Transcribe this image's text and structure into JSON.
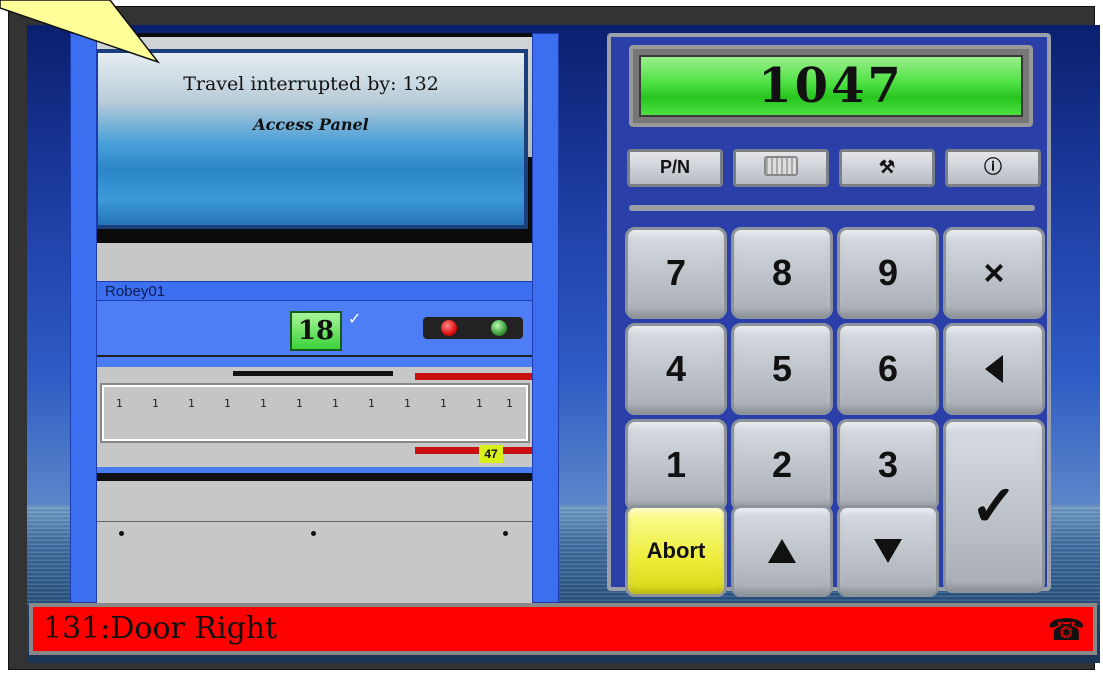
{
  "message": {
    "line1": "Travel interrupted by: 132",
    "line2": "Access Panel"
  },
  "machine": {
    "name": "Robey01",
    "level": "18",
    "level_check": "✓",
    "ruler_ticks": [
      "1",
      "1",
      "1",
      "1",
      "1",
      "1",
      "1",
      "1",
      "1",
      "1",
      "1",
      "1"
    ],
    "position_badge": "47"
  },
  "keypad": {
    "display_value": "1047",
    "tools": {
      "pn_label": "P/N",
      "keyboard_icon": "keyboard-icon",
      "tools_icon": "tools-icon",
      "info_icon": "info-icon"
    },
    "keys": {
      "k7": "7",
      "k8": "8",
      "k9": "9",
      "clear": "×",
      "k4": "4",
      "k5": "5",
      "k6": "6",
      "k1": "1",
      "k2": "2",
      "k3": "3",
      "abort": "Abort",
      "enter": "✓"
    }
  },
  "status": {
    "text": "131:Door Right",
    "phone_icon": "phone-icon"
  },
  "colors": {
    "status_bg": "#ff0000",
    "display_green": "#4ee044",
    "abort_yellow": "#eded3a",
    "panel_blue": "#2a3fa8"
  }
}
